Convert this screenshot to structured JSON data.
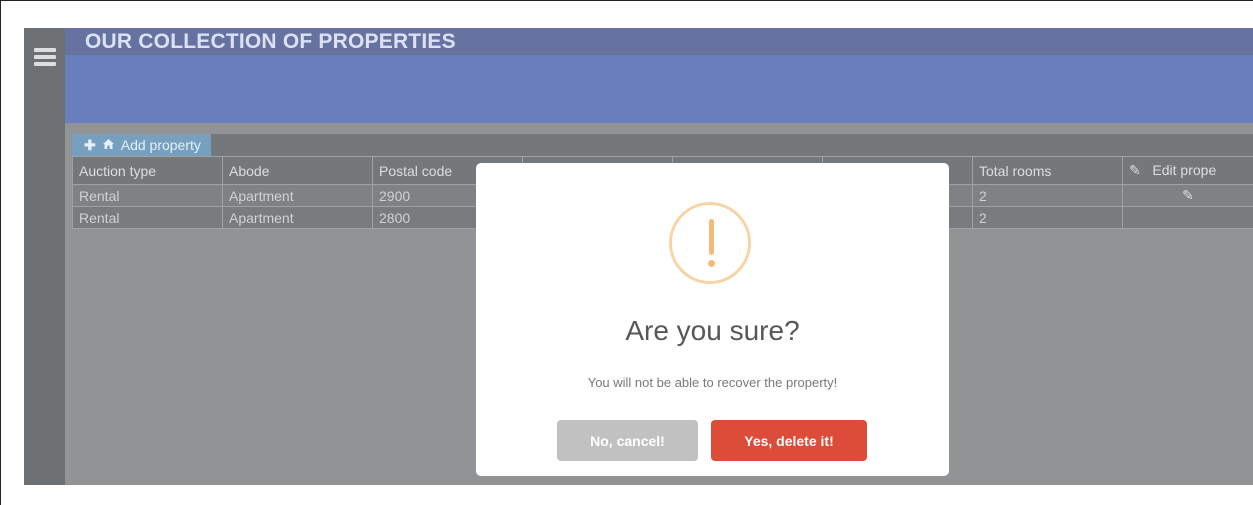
{
  "header": {
    "title": "OUR COLLECTION OF PROPERTIES"
  },
  "toolbar": {
    "add_label": "Add property",
    "add_icons": "✚ 🏠"
  },
  "table": {
    "columns": [
      "Auction type",
      "Abode",
      "Postal code",
      "",
      "",
      "",
      "Total rooms",
      "Edit prope"
    ],
    "rows": [
      [
        "Rental",
        "Apartment",
        "2900",
        "",
        "",
        "",
        "2",
        ""
      ],
      [
        "Rental",
        "Apartment",
        "2800",
        "",
        "",
        "",
        "2",
        ""
      ]
    ]
  },
  "dialog": {
    "title": "Are you sure?",
    "text": "You will not be able to recover the property!",
    "cancel_label": "No, cancel!",
    "confirm_label": "Yes, delete it!"
  },
  "colors": {
    "topbar": "#14286f",
    "banner": "#1b3a9a",
    "add_button": "#2f6e9f",
    "warning": "#f3bb76",
    "confirm": "#dd4b39",
    "cancel": "#c1c1c1"
  },
  "icons": [
    "menu-icon",
    "plus-icon",
    "home-icon",
    "edit-icon",
    "warning-icon"
  ]
}
